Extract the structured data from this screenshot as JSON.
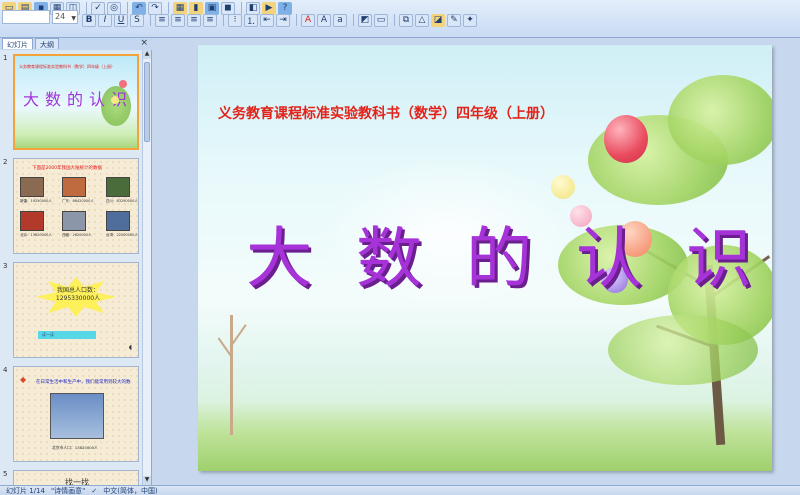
{
  "toolbar": {
    "font_size": "24",
    "buttons_row1": [
      "new",
      "open",
      "save",
      "print",
      "preview",
      "undo",
      "redo",
      "table",
      "chart",
      "paste",
      "cut",
      "copy",
      "help"
    ],
    "buttons_row2": [
      "bold",
      "italic",
      "underline",
      "strike",
      "shadow",
      "align-left",
      "center",
      "align-right",
      "justify",
      "bullets",
      "numbering",
      "indent",
      "font-color",
      "shapes",
      "arrange"
    ]
  },
  "panel": {
    "tab_slides": "幻灯片",
    "tab_outline": "大纲",
    "close": "×"
  },
  "thumbnails": {
    "t1": {
      "num": "1",
      "sub": "义务教育课程标准实验教科书（数学）四年级（上册）",
      "title": "大数的认识"
    },
    "t2": {
      "num": "2",
      "head": "下面是2000年我国大陆统计的数据",
      "captions": [
        "新疆：19250000人",
        "广东：86420000人",
        "四川：83290000人",
        "北京：13820000人",
        "西藏：2620000人",
        "台湾：22000000人"
      ]
    },
    "t3": {
      "num": "3",
      "star_text": "我国总人口数：1295330000人",
      "bar_text": "读一读"
    },
    "t4": {
      "num": "4",
      "head": "在日常生活中和生产中，我们能常用到较大的数",
      "caption": "北京市人口：13820000人"
    },
    "t5": {
      "num": "5",
      "head": "找一找"
    }
  },
  "slide": {
    "subtitle": "义务教育课程标准实验教科书（数学）四年级（上册）",
    "title": "大数的认识"
  },
  "status": {
    "slide_index": "幻灯片 1/14",
    "theme": "\"诗情画意\"",
    "language": "中文(简体，中国)"
  },
  "colors": {
    "subtitle": "#e2231a",
    "title": "#a533d8",
    "selection": "#f3a33a"
  }
}
